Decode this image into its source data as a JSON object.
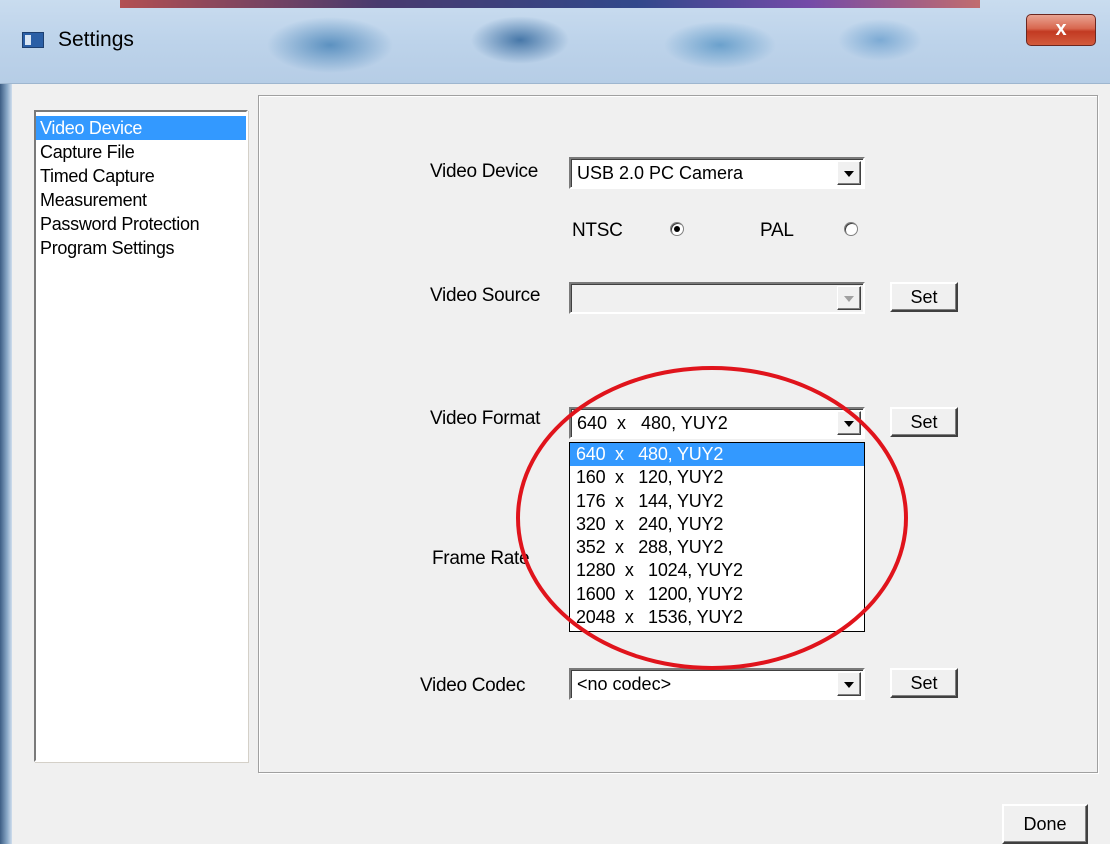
{
  "window": {
    "title": "Settings",
    "close_glyph": "x"
  },
  "sidebar": {
    "items": [
      {
        "label": "Video Device",
        "selected": true
      },
      {
        "label": "Capture File",
        "selected": false
      },
      {
        "label": "Timed Capture",
        "selected": false
      },
      {
        "label": "Measurement",
        "selected": false
      },
      {
        "label": "Password Protection",
        "selected": false
      },
      {
        "label": "Program Settings",
        "selected": false
      }
    ]
  },
  "form": {
    "video_device": {
      "label": "Video Device",
      "value": "USB 2.0 PC Camera"
    },
    "standard": {
      "ntsc_label": "NTSC",
      "ntsc_checked": true,
      "pal_label": "PAL",
      "pal_checked": false
    },
    "video_source": {
      "label": "Video Source",
      "value": "",
      "button": "Set",
      "enabled": false
    },
    "video_format": {
      "label": "Video Format",
      "value": "640  x   480, YUY2",
      "button": "Set",
      "options": [
        "640  x   480, YUY2",
        "160  x   120, YUY2",
        "176  x   144, YUY2",
        "320  x   240, YUY2",
        "352  x   288, YUY2",
        "1280  x   1024, YUY2",
        "1600  x   1200, YUY2",
        "2048  x   1536, YUY2"
      ],
      "selected_index": 0
    },
    "frame_rate": {
      "label": "Frame Rate"
    },
    "video_codec": {
      "label": "Video Codec",
      "value": "<no codec>",
      "button": "Set"
    }
  },
  "footer": {
    "done_button": "Done"
  },
  "colors": {
    "selection": "#3399ff",
    "annotation": "#e0141c",
    "window_bg": "#f0f0f0"
  }
}
